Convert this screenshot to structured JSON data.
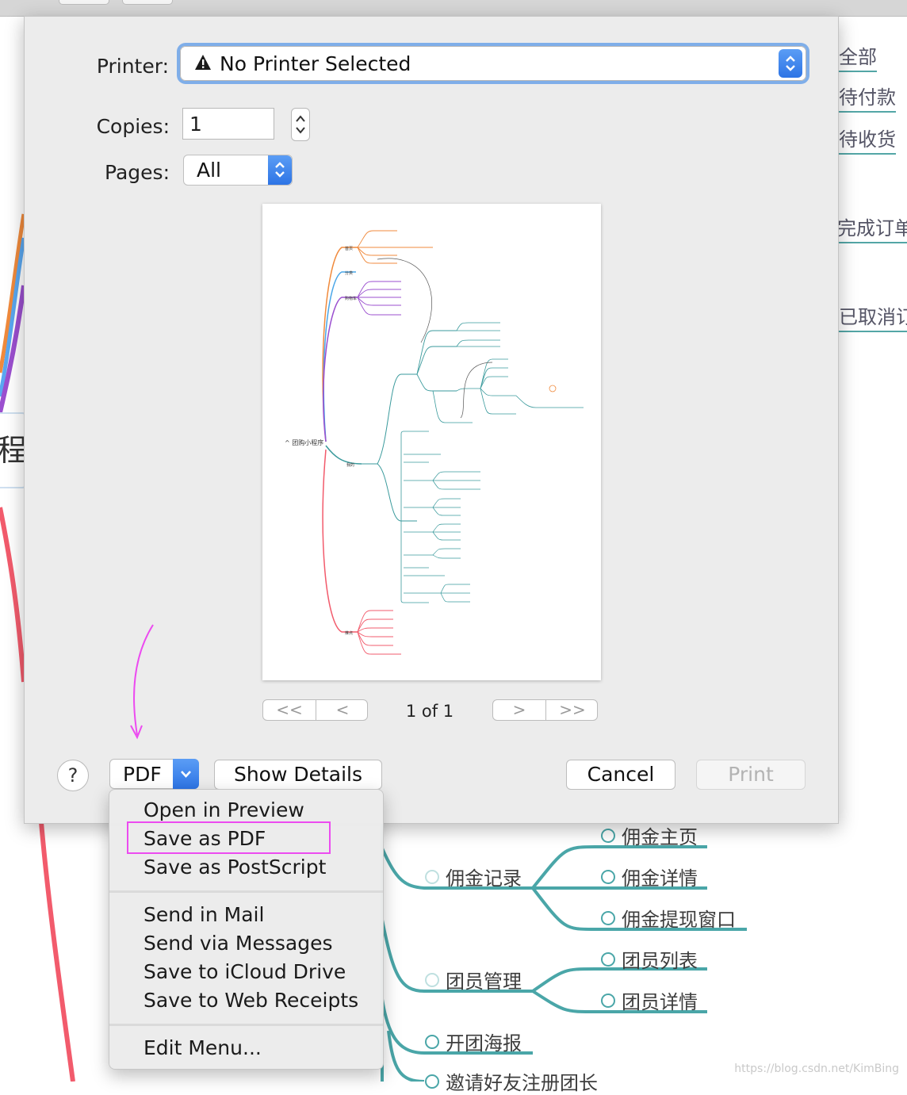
{
  "dialog": {
    "printer_label": "Printer:",
    "printer_value": "No Printer Selected",
    "copies_label": "Copies:",
    "copies_value": "1",
    "pages_label": "Pages:",
    "pages_value": "All",
    "page_indicator": "1 of 1",
    "nav": {
      "first": "<<",
      "prev": "<",
      "next": ">",
      "last": ">>"
    },
    "help_label": "?",
    "pdf_label": "PDF",
    "show_details_label": "Show Details",
    "cancel_label": "Cancel",
    "print_label": "Print"
  },
  "pdf_menu": {
    "items": [
      "Open in Preview",
      "Save as PDF",
      "Save as PostScript",
      "Send in Mail",
      "Send via Messages",
      "Save to iCloud Drive",
      "Save to Web Receipts",
      "Edit Menu..."
    ],
    "highlighted": "Save as PDF"
  },
  "background": {
    "right_tabs": [
      "全部",
      "待付款",
      "待收货",
      "完成订单",
      "已取消订单"
    ],
    "left_fragment": "程",
    "nodes": [
      "佣金记录",
      "佣金主页",
      "佣金详情",
      "佣金提现窗口",
      "团员管理",
      "团员列表",
      "团员详情",
      "开团海报",
      "邀请好友注册团长"
    ],
    "watermark": "https://blog.csdn.net/KimBing"
  },
  "preview": {
    "root": "团购小程序",
    "branches": [
      "首页",
      "分类",
      "购物车",
      "我的",
      "推点"
    ]
  },
  "colors": {
    "teal": "#4aa6a8",
    "highlight": "#ec4bf0",
    "accent_blue": "#2d74e5"
  }
}
